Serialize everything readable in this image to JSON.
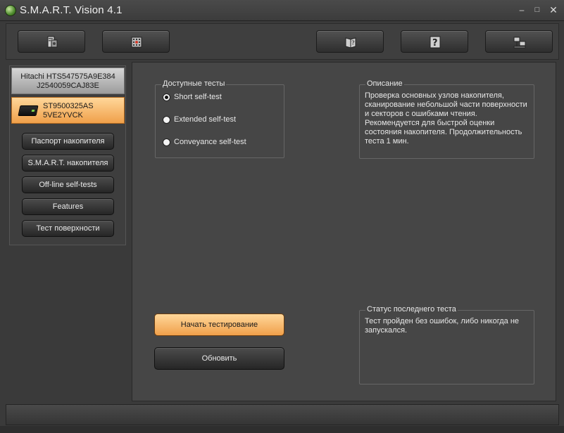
{
  "window": {
    "title": "S.M.A.R.T. Vision 4.1",
    "min_glyph": "–",
    "max_glyph": "□",
    "close_glyph": "✕"
  },
  "toolbar": {
    "buttons": [
      {
        "icon": "disk-drive-icon"
      },
      {
        "icon": "chip-icon"
      },
      {
        "icon": "help-book-icon"
      },
      {
        "icon": "question-icon"
      },
      {
        "icon": "network-icon"
      }
    ]
  },
  "drives": [
    {
      "line1": "Hitachi HTS547575A9E384",
      "line2": "J2540059CAJ83E",
      "selected": false
    },
    {
      "line1": "ST9500325AS",
      "line2": "5VE2YVCK",
      "selected": true
    }
  ],
  "nav": {
    "items": [
      "Паспорт накопителя",
      "S.M.A.R.T. накопителя",
      "Off-line self-tests",
      "Features",
      "Тест поверхности"
    ]
  },
  "tests": {
    "legend": "Доступные тесты",
    "options": [
      {
        "label": "Short self-test",
        "selected": true
      },
      {
        "label": "Extended self-test",
        "selected": false
      },
      {
        "label": "Conveyance self-test",
        "selected": false
      }
    ]
  },
  "description": {
    "legend": "Описание",
    "text": "Проверка основных узлов накопителя, сканирование небольшой части поверхности и секторов с ошибками чтения. Рекомендуется для быстрой оценки состояния накопителя. Продолжительность теста 1 мин."
  },
  "last_status": {
    "legend": "Статус последнего теста",
    "text": "Тест пройден без ошибок, либо никогда не запускался."
  },
  "actions": {
    "start_label": "Начать тестирование",
    "refresh_label": "Обновить"
  },
  "colors": {
    "accent_orange": "#f0a04a",
    "background": "#3a3a3a"
  }
}
